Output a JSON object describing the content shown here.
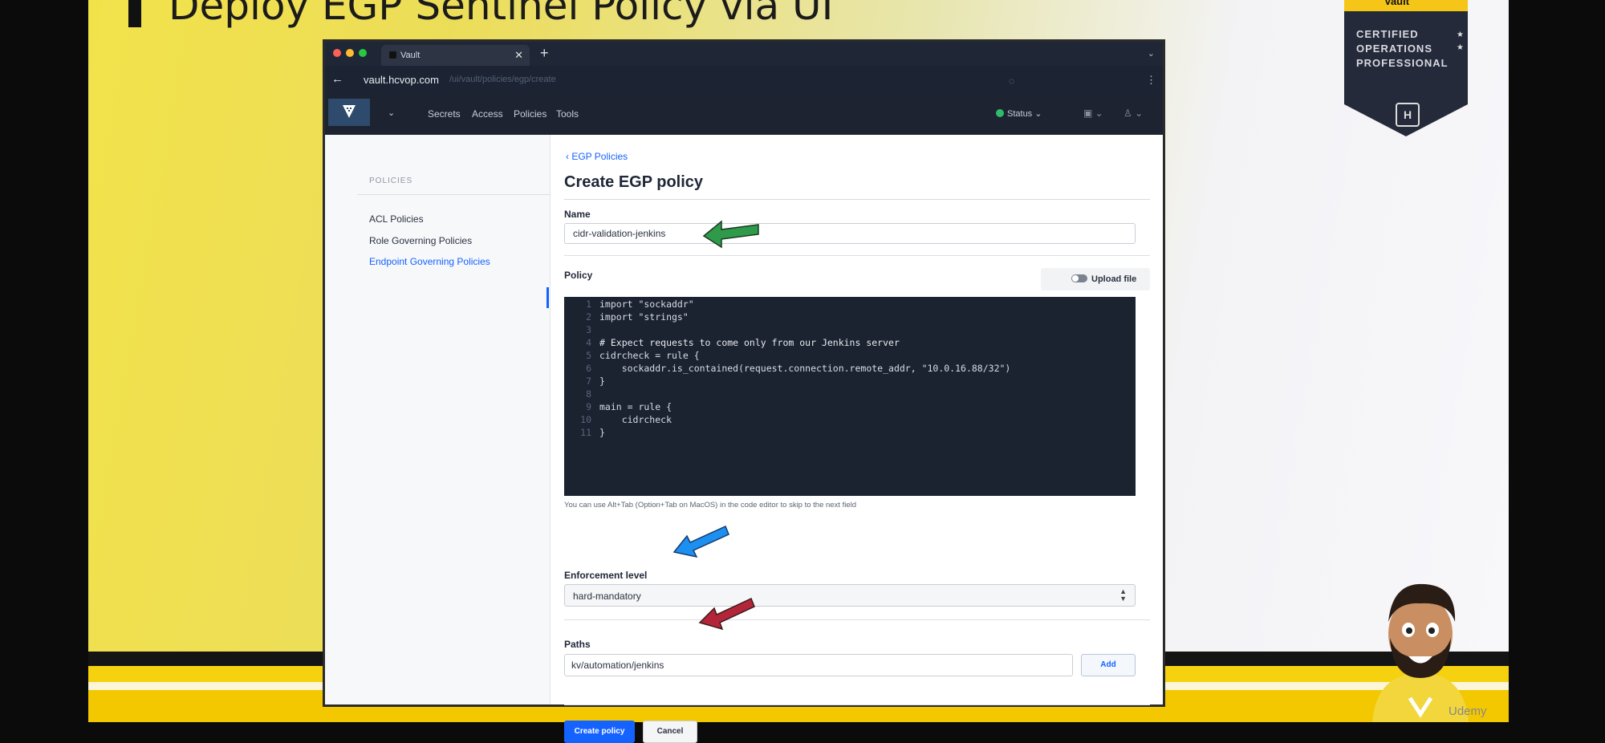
{
  "slide": {
    "title": "Deploy EGP Sentinel Policy via UI",
    "badge": {
      "vault": "Vault",
      "lines": [
        "CERTIFIED",
        "OPERATIONS",
        "PROFESSIONAL"
      ]
    },
    "watermark": "Udemy"
  },
  "browser": {
    "tab_title": "Vault",
    "new_tab": "+",
    "url_host": "vault.hcvop.com",
    "url_path": "/ui/vault/policies/egp/create"
  },
  "navbar": {
    "items": [
      "Secrets",
      "Access",
      "Policies",
      "Tools"
    ],
    "status": "Status"
  },
  "sidebar": {
    "heading": "POLICIES",
    "items": [
      {
        "label": "ACL Policies"
      },
      {
        "label": "Role Governing Policies"
      },
      {
        "label": "Endpoint Governing Policies"
      }
    ]
  },
  "main": {
    "breadcrumb": "EGP Policies",
    "title": "Create EGP policy",
    "name_label": "Name",
    "name_value": "cidr-validation-jenkins",
    "policy_label": "Policy",
    "upload_label": "Upload file",
    "code_lines": [
      "import \"sockaddr\"",
      "import \"strings\"",
      "",
      "# Expect requests to come only from our Jenkins server",
      "cidrcheck = rule {",
      "    sockaddr.is_contained(request.connection.remote_addr, \"10.0.16.88/32\")",
      "}",
      "",
      "main = rule {",
      "    cidrcheck",
      "}"
    ],
    "editor_hint": "You can use Alt+Tab (Option+Tab on MacOS) in the code editor to skip to the next field",
    "enforcement_label": "Enforcement level",
    "enforcement_value": "hard-mandatory",
    "paths_label": "Paths",
    "path_value": "kv/automation/jenkins",
    "add_label": "Add",
    "create_label": "Create policy",
    "cancel_label": "Cancel"
  },
  "colors": {
    "accent": "#1563ff",
    "arrow_name": "#2e9a4a",
    "arrow_enforcement": "#1d8ff0",
    "arrow_paths": "#b3263a"
  }
}
